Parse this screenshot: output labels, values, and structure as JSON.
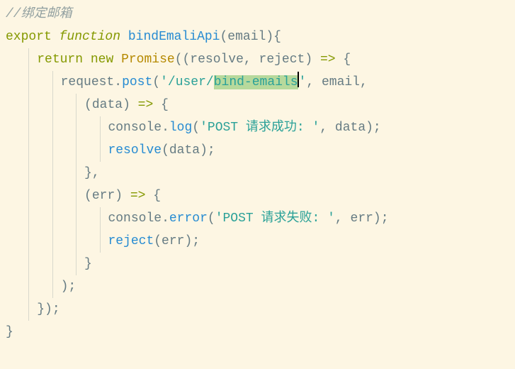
{
  "code": {
    "l1_comment": "//绑定邮箱",
    "l2_export": "export",
    "l2_function": "function",
    "l2_name": "bindEmaliApi",
    "l2_open_paren": "(",
    "l2_param": "email",
    "l2_close_paren_brace": "){",
    "l3_return": "return",
    "l3_new": "new",
    "l3_Promise": "Promise",
    "l3_open": "((",
    "l3_resolve": "resolve",
    "l3_comma": ", ",
    "l3_reject": "reject",
    "l3_close": ")",
    "l3_arrow": " => ",
    "l3_brace": "{",
    "l4_obj": "request",
    "l4_dot": ".",
    "l4_method": "post",
    "l4_open": "(",
    "l4_str_a": "'/user/",
    "l4_sel": "bind-emails",
    "l4_str_b": "'",
    "l4_rest": ", email,",
    "l5_open": "(",
    "l5_param": "data",
    "l5_close": ")",
    "l5_arrow": " => ",
    "l5_brace": "{",
    "l6_obj": "console",
    "l6_dot": ".",
    "l6_method": "log",
    "l6_open": "(",
    "l6_str": "'POST 请求成功: '",
    "l6_rest": ", data);",
    "l7_call": "resolve",
    "l7_rest": "(data);",
    "l8_close": "},",
    "l9_open": "(",
    "l9_param": "err",
    "l9_close": ")",
    "l9_arrow": " => ",
    "l9_brace": "{",
    "l10_obj": "console",
    "l10_dot": ".",
    "l10_method": "error",
    "l10_open": "(",
    "l10_str": "'POST 请求失败: '",
    "l10_rest": ", err);",
    "l11_call": "reject",
    "l11_rest": "(err);",
    "l12_close": "}",
    "l13_close": ");",
    "l14_close": "});",
    "l15_close": "}"
  }
}
